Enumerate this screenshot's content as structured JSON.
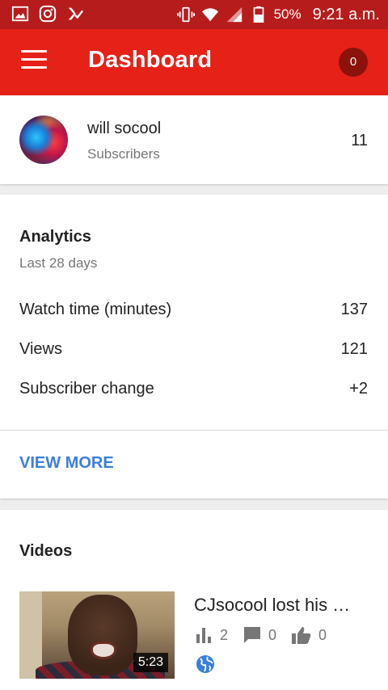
{
  "status_bar": {
    "battery": "50%",
    "time": "9:21 a.m."
  },
  "app_bar": {
    "title": "Dashboard",
    "notification_count": "0"
  },
  "channel": {
    "name": "will socool",
    "subscribers_label": "Subscribers",
    "subscribers_count": "11"
  },
  "analytics": {
    "title": "Analytics",
    "period": "Last 28 days",
    "metrics": [
      {
        "label": "Watch time (minutes)",
        "value": "137"
      },
      {
        "label": "Views",
        "value": "121"
      },
      {
        "label": "Subscriber change",
        "value": "+2"
      }
    ],
    "view_more": "VIEW MORE"
  },
  "videos": {
    "heading": "Videos",
    "items": [
      {
        "title": "CJsocool lost his …",
        "duration": "5:23",
        "views": "2",
        "comments": "0",
        "likes": "0"
      }
    ]
  },
  "colors": {
    "status_bar": "#b71c1c",
    "app_bar": "#e62117",
    "badge": "#8c120c",
    "link": "#3a7fd9"
  }
}
